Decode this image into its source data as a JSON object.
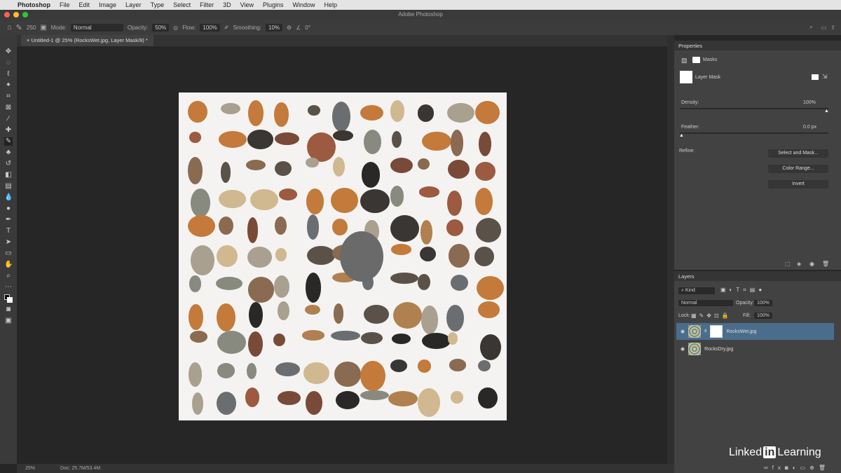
{
  "menubar": {
    "app": "Photoshop",
    "items": [
      "File",
      "Edit",
      "Image",
      "Layer",
      "Type",
      "Select",
      "Filter",
      "3D",
      "View",
      "Plugins",
      "Window",
      "Help"
    ]
  },
  "window": {
    "title": "Adobe Photoshop"
  },
  "options": {
    "brush_size": "250",
    "mode_label": "Mode:",
    "mode": "Normal",
    "opacity_label": "Opacity:",
    "opacity": "50%",
    "flow_label": "Flow:",
    "flow": "100%",
    "smoothing_label": "Smoothing:",
    "smoothing": "10%",
    "angle": "0°"
  },
  "document": {
    "tab": "Untitled-1 @ 25% (RocksWet.jpg, Layer Mask/8) *"
  },
  "properties": {
    "title": "Properties",
    "section": "Masks",
    "mask_label": "Layer Mask",
    "density_label": "Density:",
    "density": "100%",
    "feather_label": "Feather:",
    "feather": "0.0 px",
    "refine_label": "Refine:",
    "buttons": [
      "Select and Mask...",
      "Color Range...",
      "Invert"
    ]
  },
  "layers": {
    "title": "Layers",
    "filter": "Kind",
    "blend": "Normal",
    "opacity_label": "Opacity:",
    "opacity": "100%",
    "lock_label": "Lock:",
    "fill_label": "Fill:",
    "fill": "100%",
    "items": [
      {
        "name": "RocksWet.jpg",
        "selected": true
      },
      {
        "name": "RocksDry.jpg",
        "selected": false
      }
    ]
  },
  "status": {
    "zoom": "25%",
    "doc": "Doc: 25.7M/53.4M"
  },
  "watermark": {
    "linkedin": "Linked",
    "in": "in",
    "learning": "Learning"
  },
  "colors": {
    "accent": "#4a6d8c"
  }
}
